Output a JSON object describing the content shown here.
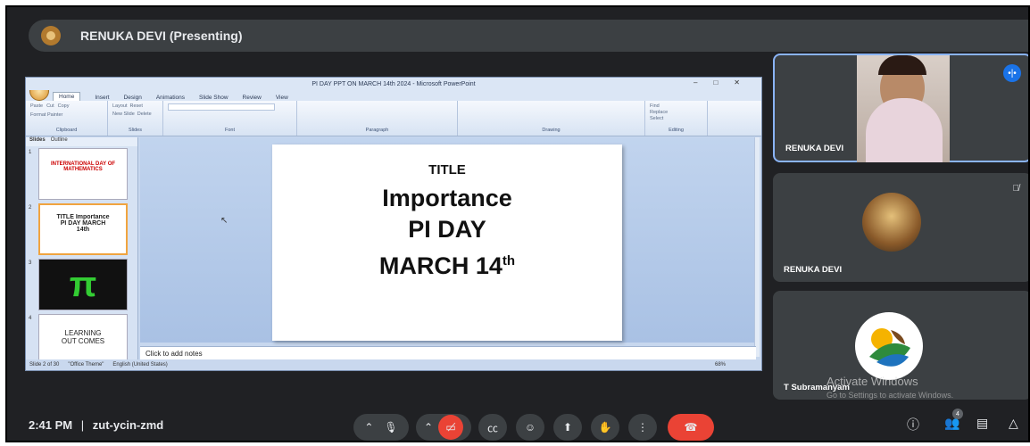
{
  "presenter": {
    "name": "RENUKA DEVI (Presenting)"
  },
  "ppt": {
    "window_title": "PI DAY PPT ON MARCH 14th 2024 - Microsoft PowerPoint",
    "tabs": [
      "Home",
      "Insert",
      "Design",
      "Animations",
      "Slide Show",
      "Review",
      "View"
    ],
    "ribbon_groups": [
      "Clipboard",
      "Slides",
      "Font",
      "Paragraph",
      "Drawing",
      "Editing"
    ],
    "clipboard_items": [
      "Cut",
      "Copy",
      "Paste",
      "Format Painter"
    ],
    "slides_items": [
      "Layout",
      "Reset",
      "New Slide",
      "Delete"
    ],
    "editing_items": [
      "Find",
      "Replace",
      "Select"
    ],
    "pane_tabs": [
      "Slides",
      "Outline"
    ],
    "thumbs": [
      {
        "num": "1",
        "text": "INTERNATIONAL DAY OF MATHEMATICS"
      },
      {
        "num": "2",
        "text": "TITLE Importance PI DAY MARCH 14th"
      },
      {
        "num": "3",
        "text": "π"
      },
      {
        "num": "4",
        "text": "LEARNING OUT COMES"
      }
    ],
    "slide": {
      "title": "TITLE",
      "line1": "Importance",
      "line2": "PI DAY",
      "line3": "MARCH  14",
      "sup": "th"
    },
    "notes_placeholder": "Click to add notes",
    "status": {
      "slide": "Slide 2 of 30",
      "theme": "\"Office Theme\"",
      "language": "English (United States)",
      "zoom": "68%"
    }
  },
  "tiles": [
    {
      "name": "RENUKA DEVI"
    },
    {
      "name": "RENUKA DEVI"
    },
    {
      "name": "T Subramanyam"
    }
  ],
  "watermark": {
    "line1": "Activate Windows",
    "line2": "Go to Settings to activate Windows."
  },
  "bottom": {
    "time": "2:41 PM",
    "separator": "|",
    "code": "zut-ycin-zmd",
    "people_count": "4"
  }
}
